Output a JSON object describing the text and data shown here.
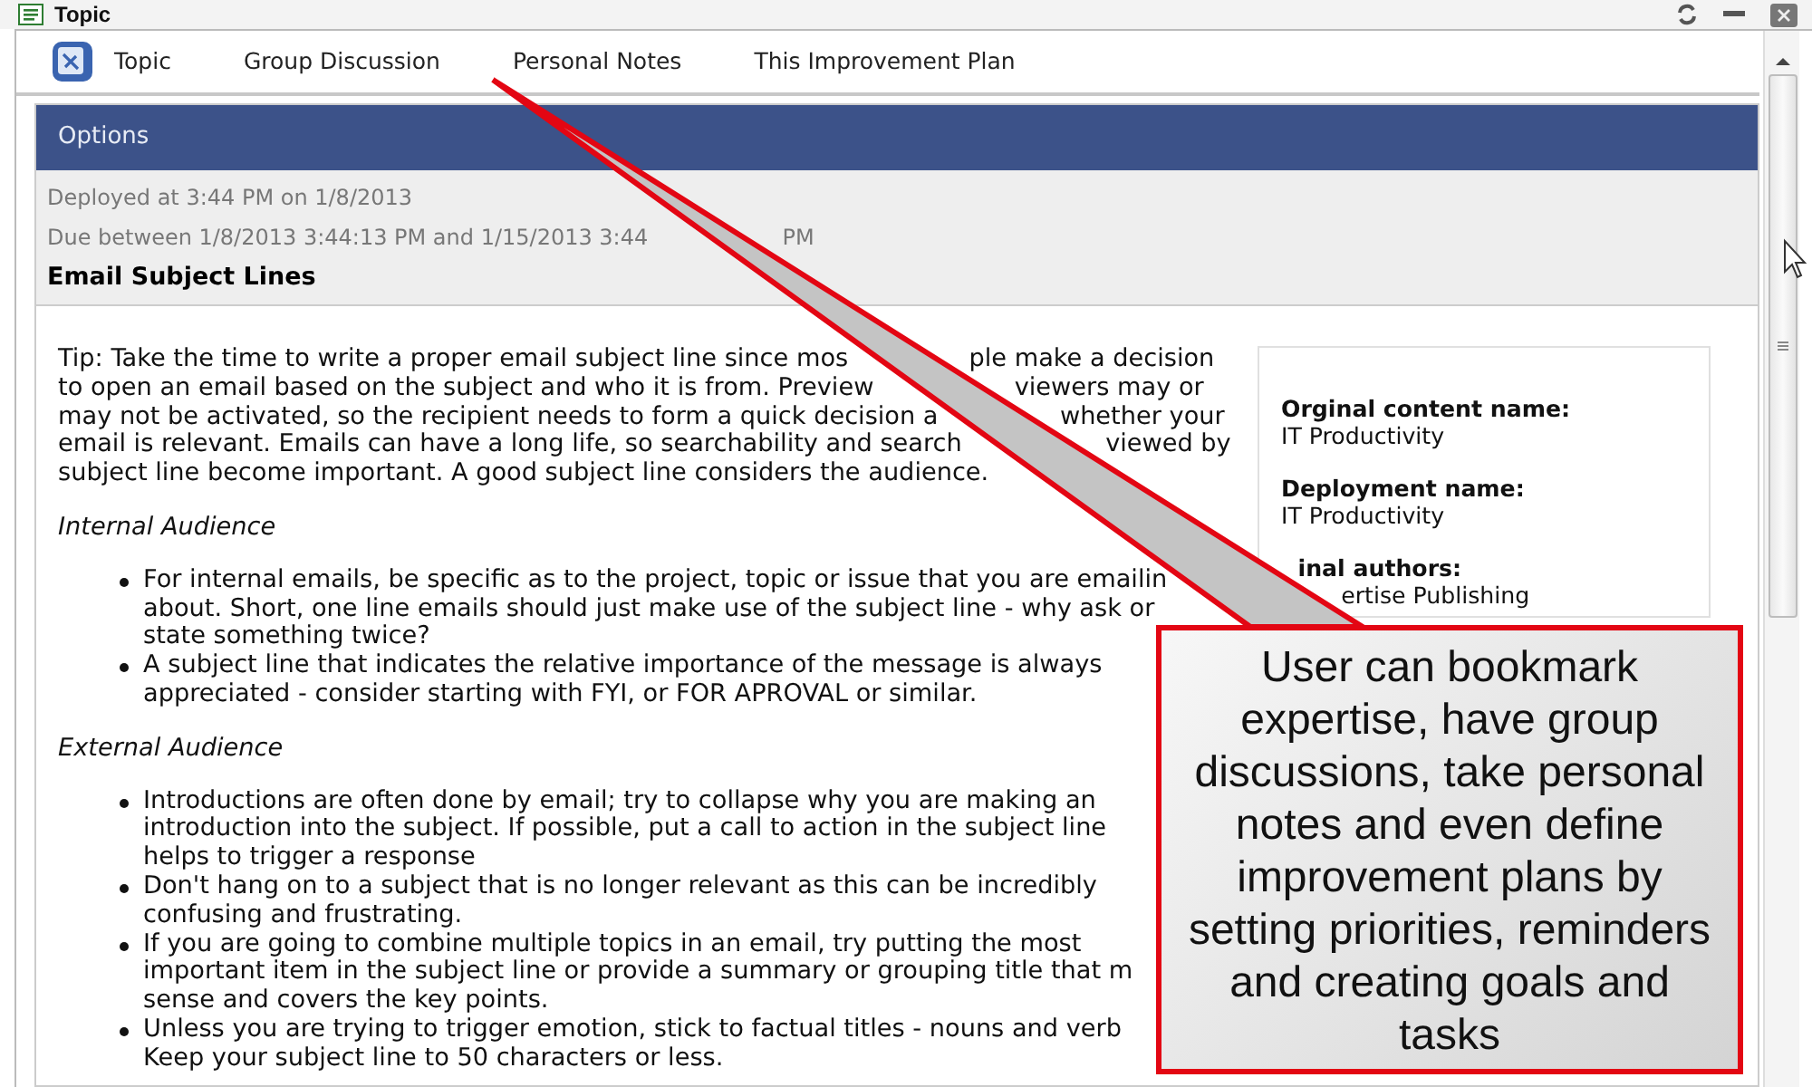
{
  "window": {
    "title": "Topic"
  },
  "tabs": [
    {
      "label": "Topic"
    },
    {
      "label": "Group Discussion"
    },
    {
      "label": "Personal Notes"
    },
    {
      "label": "This Improvement Plan"
    }
  ],
  "options": {
    "title": "Options",
    "deployed": "Deployed at 3:44 PM on 1/8/2013",
    "due": [
      "Due between 1/8/2013 3:44:13 PM and 1/15/2013 3:44",
      "PM"
    ]
  },
  "article": {
    "heading": "Email Subject Lines",
    "tip_lines": [
      [
        "Tip:  Take the time to write a proper email subject line since mos",
        "ple make a decision"
      ],
      [
        "to open an email based on the subject and who it is from. Preview",
        "viewers may or"
      ],
      [
        "may not be activated, so the recipient needs to form a quick decision a",
        "whether your"
      ],
      [
        "email is relevant. Emails can have a long life, so searchability and search",
        "viewed by"
      ],
      [
        "subject line become important. A good subject line considers the audience."
      ]
    ],
    "sections": [
      {
        "title": "Internal Audience",
        "bullets": [
          [
            "For internal emails, be specific as to the project, topic or issue that you are emailin",
            "about. Short, one line emails should just make use of the subject line - why ask or",
            "state something twice?"
          ],
          [
            "A subject line that indicates the relative importance of the message is always",
            "appreciated - consider starting with FYI, or FOR APROVAL or similar."
          ]
        ]
      },
      {
        "title": "External Audience",
        "bullets": [
          [
            "Introductions are often done by email; try to collapse why you are making an",
            "introduction into the subject. If possible, put a call to action in the subject line",
            "helps to trigger a response"
          ],
          [
            "Don't hang on to a subject that is no longer relevant as this can be incredibly",
            "confusing and frustrating."
          ],
          [
            "If you are going to combine multiple topics in an email, try putting the most",
            "important item in the subject line or provide a summary or grouping title that m",
            "sense and covers the key points."
          ],
          [
            "Unless you are trying to trigger emotion, stick to factual titles - nouns and verb",
            "Keep your subject line to 50 characters or less."
          ]
        ]
      }
    ]
  },
  "info_box": [
    {
      "label": "Orginal content name:",
      "value": "IT Productivity"
    },
    {
      "label": "Deployment name:",
      "value": "IT Productivity"
    },
    {
      "label": "inal authors:",
      "value": "ertise Publishing"
    }
  ],
  "callout": {
    "text": "User can bookmark expertise, have group discussions, take personal notes and even define improvement plans by setting priorities, reminders and creating goals and tasks"
  }
}
